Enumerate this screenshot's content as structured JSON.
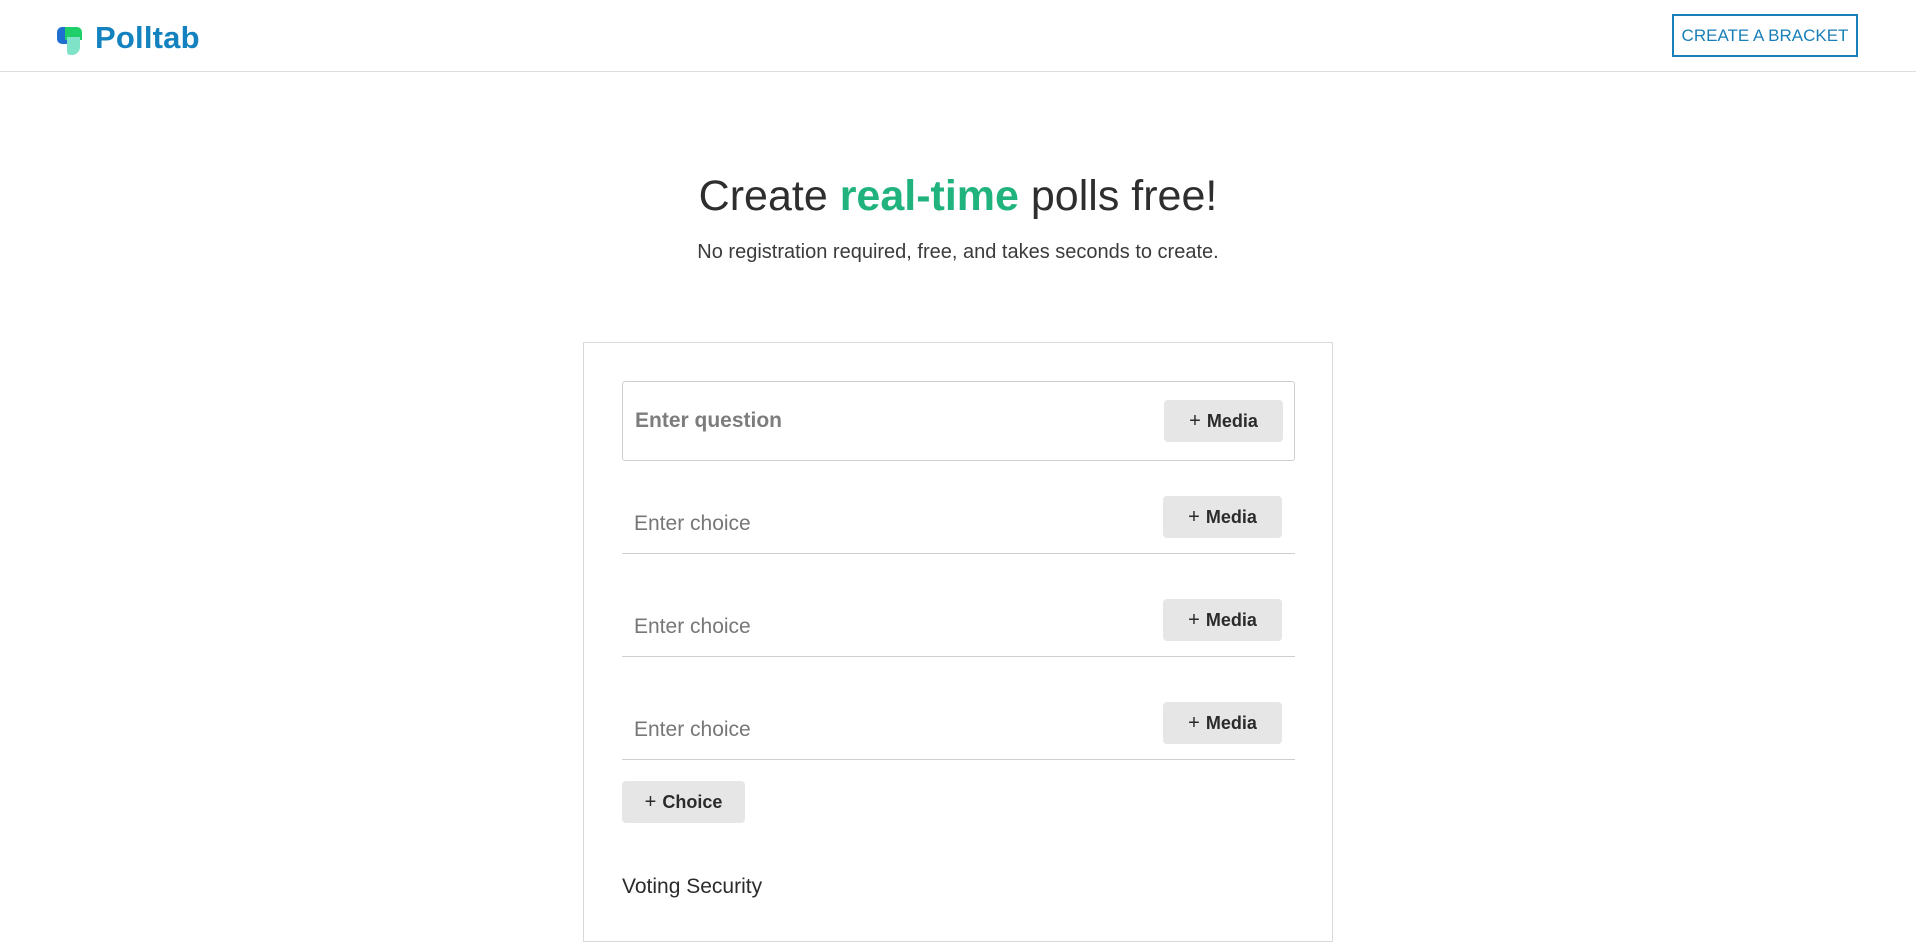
{
  "header": {
    "brand": "Polltab",
    "bracket_button": "CREATE A BRACKET"
  },
  "hero": {
    "title_before": "Create ",
    "title_accent": "real-time",
    "title_after": " polls free!",
    "subtitle": "No registration required, free, and takes seconds to create."
  },
  "form": {
    "question_placeholder": "Enter question",
    "media_label": "Media",
    "plus_glyph": "+",
    "choices": [
      {
        "placeholder": "Enter choice"
      },
      {
        "placeholder": "Enter choice"
      },
      {
        "placeholder": "Enter choice"
      }
    ],
    "add_choice_label": "Choice",
    "voting_security_title": "Voting Security"
  },
  "colors": {
    "brand": "#1482bf",
    "accent": "#20b37e",
    "button_bg": "#e6e6e6"
  }
}
